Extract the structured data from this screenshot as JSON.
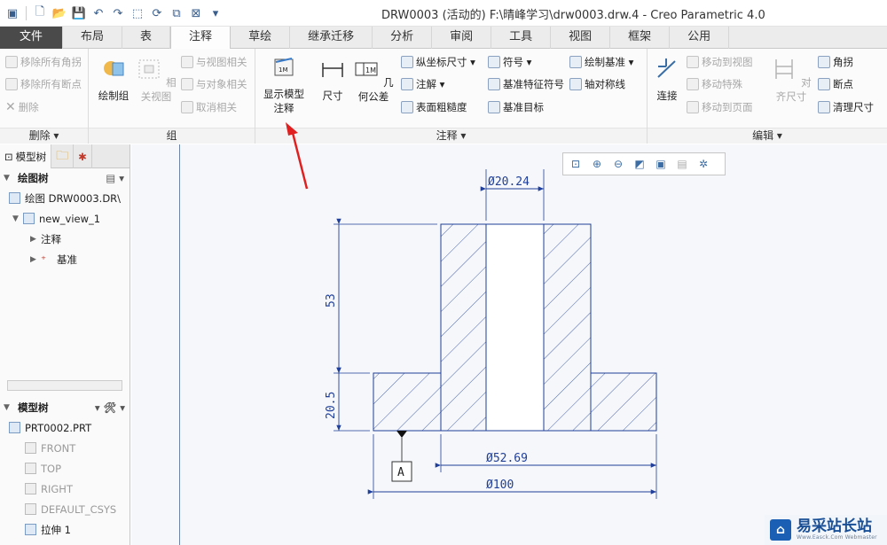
{
  "window": {
    "title": "DRW0003 (活动的) F:\\晴峰学习\\drw0003.drw.4 - Creo Parametric 4.0"
  },
  "tabs": [
    {
      "label": "文件"
    },
    {
      "label": "布局"
    },
    {
      "label": "表"
    },
    {
      "label": "注释"
    },
    {
      "label": "草绘"
    },
    {
      "label": "继承迁移"
    },
    {
      "label": "分析"
    },
    {
      "label": "审阅"
    },
    {
      "label": "工具"
    },
    {
      "label": "视图"
    },
    {
      "label": "框架"
    },
    {
      "label": "公用"
    }
  ],
  "ribbon": {
    "delete_group": {
      "footer": "删除 ▾",
      "remove_all_angles": "移除所有角拐",
      "remove_all_breaks": "移除所有断点",
      "delete": "删除"
    },
    "group_group": {
      "footer": "组",
      "draw_group": "绘制组",
      "related_view": "相关视图",
      "view_related": "与视图相关",
      "object_related": "与对象相关",
      "cancel_related": "取消相关"
    },
    "annotation_group": {
      "footer": "注释 ▾",
      "show_model_annot_line1": "显示模型",
      "show_model_annot_line2": "注释",
      "dimension": "尺寸",
      "geometric_tolerance": "几何公差",
      "ordinate_dimension": "纵坐标尺寸 ▾",
      "note": "注解 ▾",
      "surface_finish": "表面粗糙度",
      "symbol": "符号 ▾",
      "datum_feature_symbol": "基准特征符号",
      "datum_target": "基准目标",
      "draw_datum": "绘制基准 ▾",
      "axis_symmetric": "轴对称线"
    },
    "edit_group": {
      "footer": "编辑 ▾",
      "connect": "连接",
      "move_to_view": "移动到视图",
      "move_special": "移动特殊",
      "move_to_page": "移动到页面",
      "align_dimension": "对齐尺寸",
      "corner": "角拐",
      "breakpoint": "断点",
      "clean_dimension": "清理尺寸"
    }
  },
  "left_panel": {
    "tab_model_tree": "模型树",
    "drawing_tree_header": "绘图树",
    "drawing_item": "绘图 DRW0003.DR\\",
    "view_item": "new_view_1",
    "annotation_item": "注释",
    "datum_item": "基准",
    "model_tree_header": "模型树",
    "model_items": [
      {
        "label": "PRT0002.PRT"
      },
      {
        "label": "FRONT"
      },
      {
        "label": "TOP"
      },
      {
        "label": "RIGHT"
      },
      {
        "label": "DEFAULT_CSYS"
      },
      {
        "label": "拉伸 1"
      }
    ]
  },
  "drawing": {
    "dim_top": "Ø20.24",
    "dim_height": "53",
    "dim_flange": "20.5",
    "dim_mid": "Ø52.69",
    "dim_bottom": "Ø100",
    "datum_label": "A"
  },
  "watermark": {
    "name": "易采站长站",
    "sub": "Www.Easck.Com Webmaster"
  },
  "colors": {
    "accent": "#3a5e8c",
    "file_tab": "#4a4a4a",
    "annotation_arrow": "#e02020",
    "drawing_line": "#1f3f9a"
  }
}
